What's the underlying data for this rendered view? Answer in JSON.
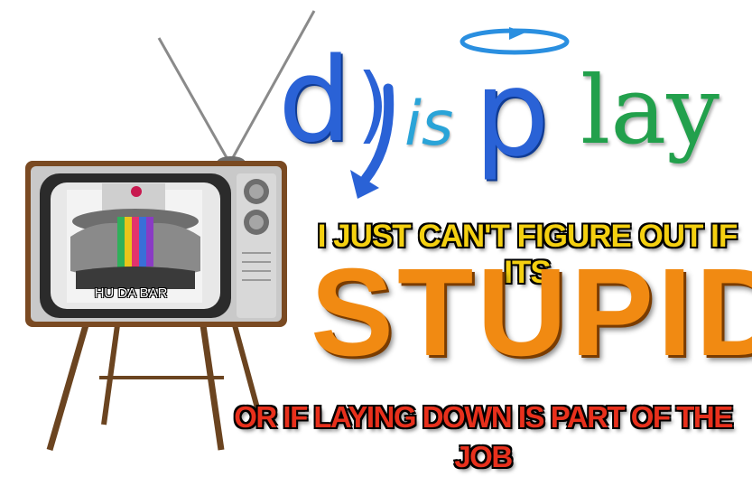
{
  "logo": {
    "letter_d": "d",
    "paren": ")",
    "letters_is": "is",
    "letter_p": "p",
    "letters_lay": "lay",
    "colors": {
      "blue": "#2a62d6",
      "cyan": "#2aa4d8",
      "green": "#22a04c"
    }
  },
  "tv": {
    "screen_caption": "HU DA BAR"
  },
  "captions": {
    "top": "I JUST CAN'T FIGURE OUT IF ITS",
    "main": "STUPID",
    "bottom": "OR IF LAYING DOWN IS PART OF THE JOB",
    "colors": {
      "top": "#f4d010",
      "main": "#f18a12",
      "bottom": "#e8301c"
    }
  }
}
